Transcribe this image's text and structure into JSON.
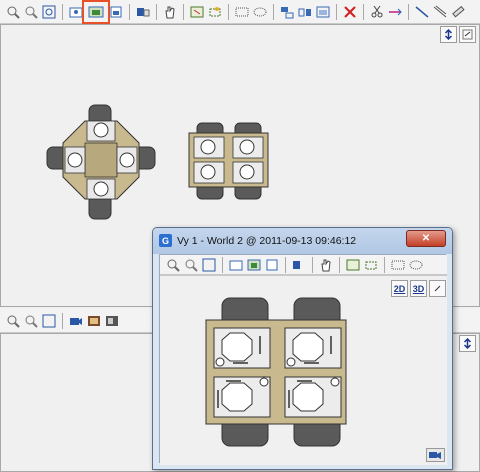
{
  "main_toolbar": {
    "buttons": [
      "zoom-in-icon",
      "zoom-out-icon",
      "zoom-fit-icon",
      "zoom-window-icon",
      "zoom-selection-icon",
      "zoom-page-icon",
      "layers-icon",
      "pan-hand-icon",
      "select-window-icon",
      "select-cross-icon",
      "dotted-rect-icon",
      "dotted-lasso-icon",
      "align-icon",
      "distribute-icon",
      "group-icon",
      "delete-icon",
      "cut-icon",
      "measure-icon",
      "line-icon",
      "dimension-icon"
    ]
  },
  "dialog": {
    "title": "Vy 1 - World 2 @ 2011-09-13 09:46:12",
    "close_label": "✕",
    "view_2d_label": "2D",
    "view_3d_label": "3D"
  },
  "colors": {
    "table_fill": "#c8b98f",
    "chair_fill": "#5a5a5a",
    "highlight": "#e8502a"
  }
}
